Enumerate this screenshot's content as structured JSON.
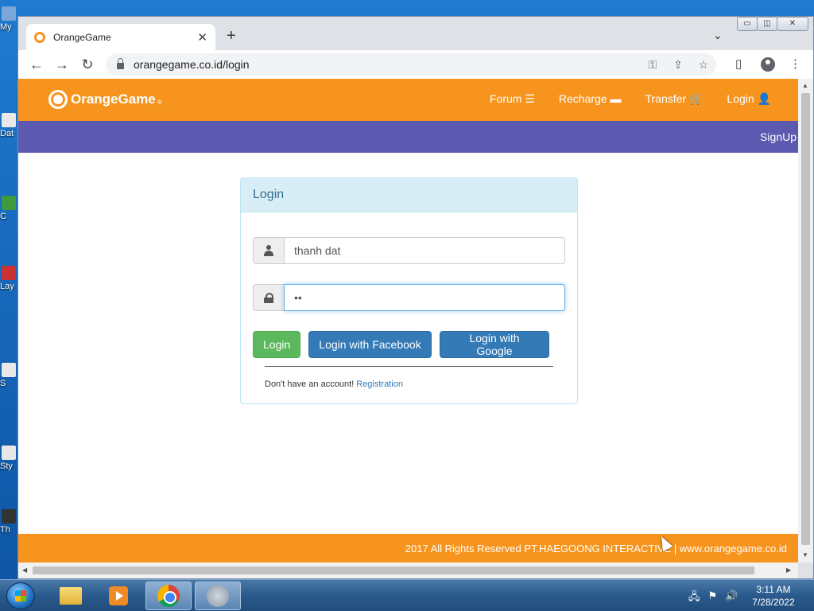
{
  "desktop": {
    "icons": [
      {
        "label": "My",
        "color": "#7aa7d8"
      },
      {
        "label": "Dat",
        "color": "#e8e8e8"
      },
      {
        "label": "C",
        "color": "#3d9a3d"
      },
      {
        "label": "Lay",
        "color": "#c83232"
      },
      {
        "label": "S",
        "color": "#e8e8e8"
      },
      {
        "label": "Sty",
        "color": "#e8e8e8"
      },
      {
        "label": "Th",
        "color": "#333333"
      }
    ]
  },
  "browser": {
    "tab_title": "OrangeGame",
    "tab_close": "✕",
    "new_tab": "+",
    "tab_menu": "⌄",
    "url": "orangegame.co.id/login",
    "window_controls": [
      "▭",
      "◫",
      "✕"
    ]
  },
  "site": {
    "logo": "OrangeGame",
    "logo_suffix": "®",
    "nav": [
      {
        "label": "Forum ☰"
      },
      {
        "label": "Recharge ▬"
      },
      {
        "label": "Transfer 🛒"
      },
      {
        "label": "Login 👤"
      }
    ],
    "signup": "SignUp",
    "login_panel": {
      "heading": "Login",
      "username_value": "thanh dat",
      "password_value": "••",
      "btn_login": "Login",
      "btn_facebook": "Login with Facebook",
      "btn_google": "Login with Google",
      "no_account": "Don't have an account!",
      "registration_link": "Registration"
    },
    "footer": "2017 All Rights Reserved PT.HAEGOONG INTERACTIVE | www.orangegame.co.id"
  },
  "colors": {
    "brand_orange": "#f7941e",
    "subnav_purple": "#5b59b0",
    "panel_heading_bg": "#d9edf7",
    "success_green": "#5cb85c",
    "primary_blue": "#337ab7"
  },
  "taskbar": {
    "time": "3:11 AM",
    "date": "7/28/2022"
  }
}
